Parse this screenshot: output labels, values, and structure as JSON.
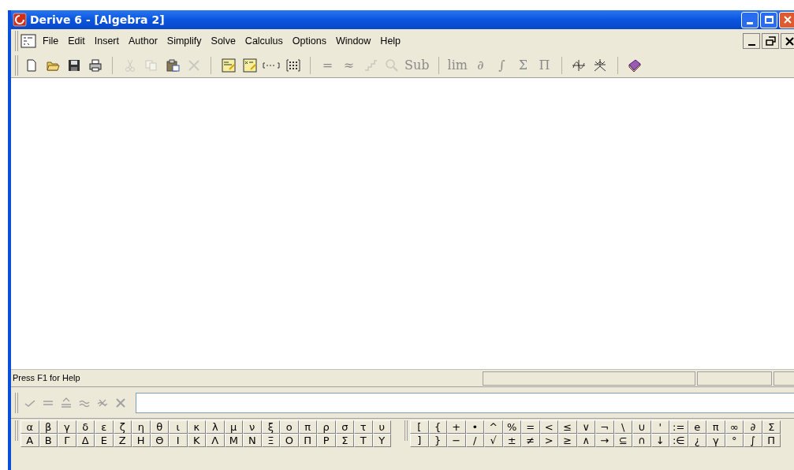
{
  "window": {
    "title": "Derive 6 - [Algebra 2]"
  },
  "menu": [
    {
      "label": "File"
    },
    {
      "label": "Edit"
    },
    {
      "label": "Insert"
    },
    {
      "label": "Author"
    },
    {
      "label": "Simplify"
    },
    {
      "label": "Solve"
    },
    {
      "label": "Calculus"
    },
    {
      "label": "Options"
    },
    {
      "label": "Window"
    },
    {
      "label": "Help"
    }
  ],
  "toolbar": [
    [
      {
        "kind": "new",
        "disabled": false
      },
      {
        "kind": "open",
        "disabled": false
      },
      {
        "kind": "save",
        "disabled": false
      },
      {
        "kind": "print",
        "disabled": false
      }
    ],
    [
      {
        "kind": "cut",
        "disabled": true
      },
      {
        "kind": "copy",
        "disabled": true
      },
      {
        "kind": "paste",
        "disabled": false
      },
      {
        "kind": "delete",
        "disabled": true
      }
    ],
    [
      {
        "kind": "text-object",
        "disabled": false
      },
      {
        "kind": "expression",
        "disabled": false
      },
      {
        "kind": "vector",
        "disabled": false
      },
      {
        "kind": "matrix",
        "disabled": false
      }
    ],
    [
      {
        "kind": "glyph",
        "label": "=",
        "disabled": true
      },
      {
        "kind": "glyph",
        "label": "≈",
        "disabled": true
      },
      {
        "kind": "steps",
        "disabled": true
      },
      {
        "kind": "zoom",
        "disabled": true
      },
      {
        "kind": "glyph",
        "label": "Sub",
        "disabled": true
      }
    ],
    [
      {
        "kind": "glyph",
        "label": "lim",
        "disabled": true
      },
      {
        "kind": "glyph",
        "label": "∂",
        "disabled": true
      },
      {
        "kind": "glyph",
        "label": "∫",
        "disabled": true
      },
      {
        "kind": "glyph",
        "label": "Σ",
        "disabled": true
      },
      {
        "kind": "glyph",
        "label": "Π",
        "disabled": true
      }
    ],
    [
      {
        "kind": "plot2d",
        "disabled": false
      },
      {
        "kind": "plot3d",
        "disabled": false
      }
    ],
    [
      {
        "kind": "help-book",
        "disabled": false
      }
    ]
  ],
  "status_bar": {
    "text": "Press F1 for Help"
  },
  "entry_bar": {
    "buttons": [
      {
        "kind": "check",
        "disabled": true
      },
      {
        "kind": "equals",
        "disabled": true
      },
      {
        "kind": "simplify",
        "disabled": true
      },
      {
        "kind": "approx",
        "disabled": true
      },
      {
        "kind": "approx-simplify",
        "disabled": true
      },
      {
        "kind": "cancel",
        "disabled": true
      }
    ]
  },
  "greek_symbols": [
    [
      "α",
      "β",
      "γ",
      "δ",
      "ε",
      "ζ",
      "η",
      "θ",
      "ι",
      "κ",
      "λ",
      "μ",
      "ν",
      "ξ",
      "ο",
      "π",
      "ρ",
      "σ",
      "τ",
      "υ"
    ],
    [
      "Α",
      "Β",
      "Γ",
      "Δ",
      "Ε",
      "Ζ",
      "Η",
      "Θ",
      "Ι",
      "Κ",
      "Λ",
      "Μ",
      "Ν",
      "Ξ",
      "Ο",
      "Π",
      "Ρ",
      "Σ",
      "Τ",
      "Υ"
    ]
  ],
  "math_symbols": [
    [
      "[",
      "{",
      "+",
      "•",
      "^",
      "%",
      "=",
      "<",
      "≤",
      "∨",
      "¬",
      "\\",
      "∪",
      "'",
      ":=",
      "e",
      "π",
      "∞",
      "∂",
      "Σ"
    ],
    [
      "]",
      "}",
      "−",
      "/",
      "√",
      "±",
      "≠",
      ">",
      "≥",
      "∧",
      "→",
      "⊆",
      "∩",
      "↓",
      ":∈",
      "¿",
      "γ",
      "°",
      "∫",
      "Π"
    ]
  ]
}
